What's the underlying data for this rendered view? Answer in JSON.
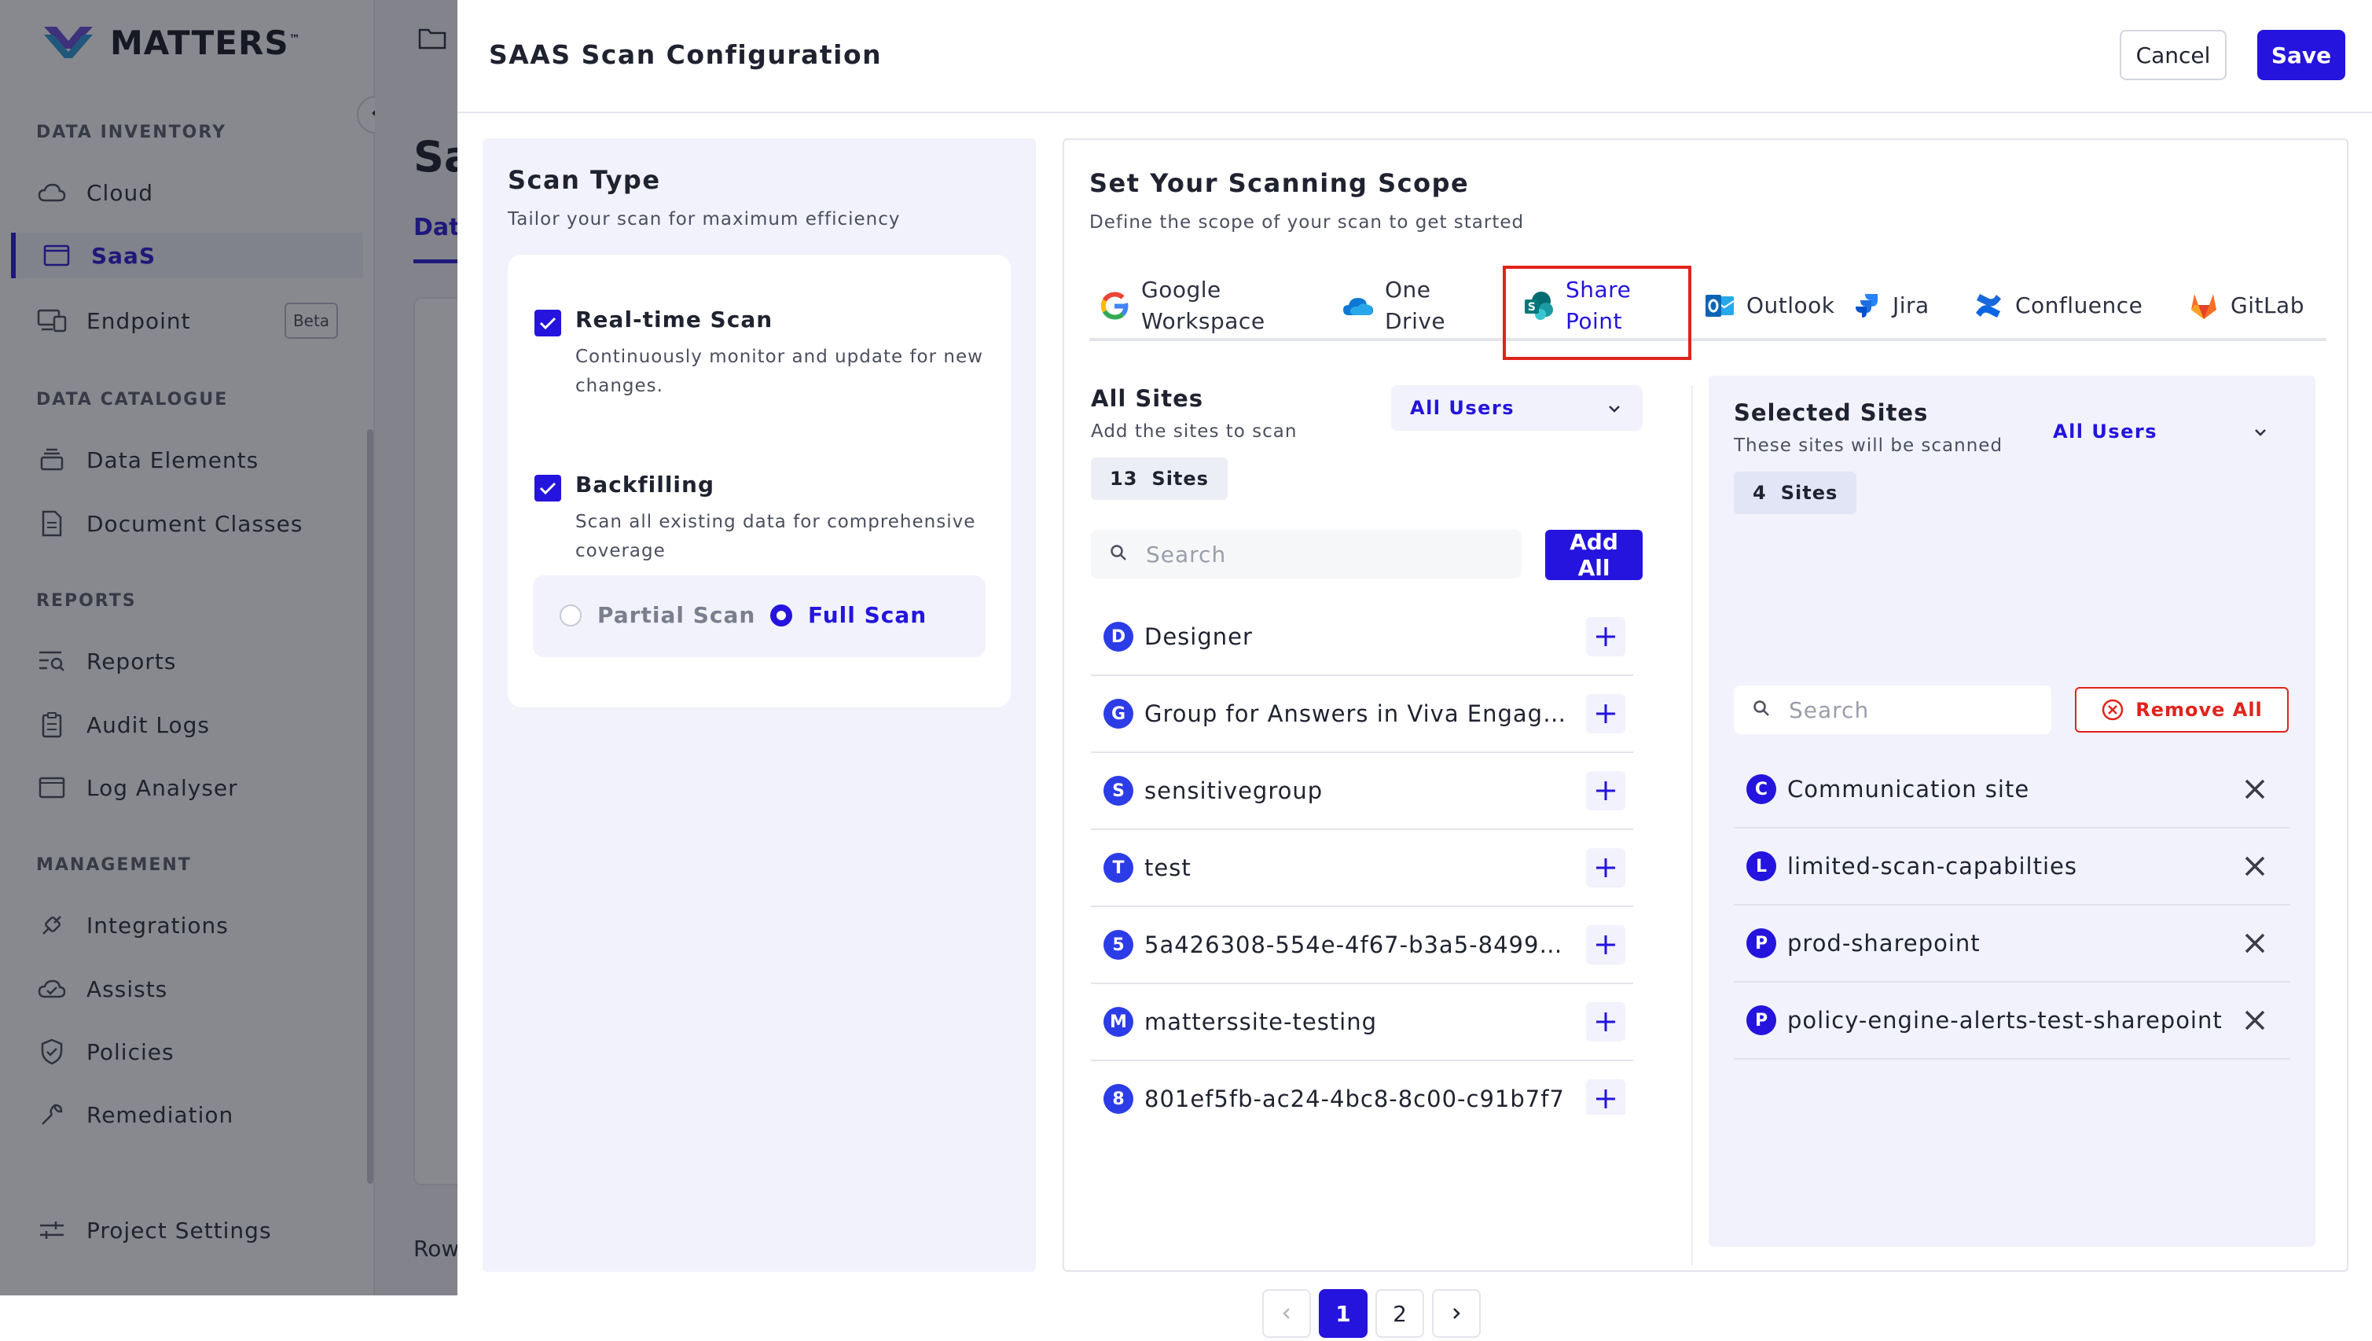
{
  "app": {
    "brand": "MATTERS",
    "brand_tm": "™"
  },
  "sidebar": {
    "sections": [
      {
        "heading": "DATA INVENTORY",
        "items": [
          {
            "label": "Cloud",
            "icon": "cloud-icon"
          },
          {
            "label": "SaaS",
            "icon": "window-icon",
            "active": true
          },
          {
            "label": "Endpoint",
            "icon": "devices-icon",
            "badge": "Beta"
          }
        ]
      },
      {
        "heading": "DATA CATALOGUE",
        "items": [
          {
            "label": "Data Elements",
            "icon": "layers-icon"
          },
          {
            "label": "Document Classes",
            "icon": "document-icon"
          }
        ]
      },
      {
        "heading": "REPORTS",
        "items": [
          {
            "label": "Reports",
            "icon": "report-search-icon"
          },
          {
            "label": "Audit Logs",
            "icon": "clipboard-icon"
          },
          {
            "label": "Log Analyser",
            "icon": "terminal-icon"
          }
        ]
      },
      {
        "heading": "MANAGEMENT",
        "items": [
          {
            "label": "Integrations",
            "icon": "plug-icon"
          },
          {
            "label": "Assists",
            "icon": "cloud-check-icon"
          },
          {
            "label": "Policies",
            "icon": "shield-check-icon"
          },
          {
            "label": "Remediation",
            "icon": "wrench-icon"
          }
        ]
      }
    ],
    "footer": {
      "label": "Project Settings",
      "icon": "sliders-icon"
    }
  },
  "background_page": {
    "title_peek": "Sa",
    "tab_peek": "Data",
    "footer_peek": "Row"
  },
  "modal": {
    "title": "SAAS Scan Configuration",
    "cancel_label": "Cancel",
    "save_label": "Save",
    "scan_type": {
      "title": "Scan Type",
      "subtitle": "Tailor your scan for maximum efficiency",
      "options": [
        {
          "label": "Real-time Scan",
          "description": "Continuously monitor and update for new changes.",
          "checked": true
        },
        {
          "label": "Backfilling",
          "description": "Scan all existing data for comprehensive coverage",
          "checked": true
        }
      ],
      "modes": [
        {
          "label": "Partial Scan",
          "selected": false
        },
        {
          "label": "Full Scan",
          "selected": true
        }
      ]
    },
    "scope": {
      "title": "Set Your Scanning Scope",
      "subtitle": "Define the scope of your scan to get started",
      "tabs": [
        {
          "line1": "Google",
          "line2": "Workspace",
          "icon": "google-icon"
        },
        {
          "line1": "One",
          "line2": "Drive",
          "icon": "onedrive-icon"
        },
        {
          "line1": "Share",
          "line2": "Point",
          "icon": "sharepoint-icon",
          "active": true
        },
        {
          "line1": "Outlook",
          "line2": "",
          "icon": "outlook-icon"
        },
        {
          "line1": "Jira",
          "line2": "",
          "icon": "jira-icon"
        },
        {
          "line1": "Confluence",
          "line2": "",
          "icon": "confluence-icon"
        },
        {
          "line1": "GitLab",
          "line2": "",
          "icon": "gitlab-icon"
        }
      ],
      "all_sites": {
        "title": "All Sites",
        "subtitle": "Add the sites to scan",
        "filter": "All Users",
        "count": "13",
        "count_label": "Sites",
        "search_placeholder": "Search",
        "add_all_label": "Add All",
        "sites": [
          {
            "initial": "D",
            "name": "Designer"
          },
          {
            "initial": "G",
            "name": "Group for Answers in Viva Engage – ..."
          },
          {
            "initial": "S",
            "name": "sensitivegroup"
          },
          {
            "initial": "T",
            "name": "test"
          },
          {
            "initial": "5",
            "name": "5a426308-554e-4f67-b3a5-8499c8..."
          },
          {
            "initial": "M",
            "name": "matterssite-testing"
          },
          {
            "initial": "8",
            "name": "801ef5fb-ac24-4bc8-8c00-c91b7f7"
          }
        ],
        "pagination": {
          "pages": [
            "1",
            "2"
          ],
          "current": "1"
        }
      },
      "selected_sites": {
        "title": "Selected Sites",
        "subtitle": "These sites will be scanned",
        "filter": "All Users",
        "count": "4",
        "count_label": "Sites",
        "search_placeholder": "Search",
        "remove_all_label": "Remove All",
        "sites": [
          {
            "initial": "C",
            "name": "Communication site"
          },
          {
            "initial": "L",
            "name": "limited-scan-capabilties"
          },
          {
            "initial": "P",
            "name": "prod-sharepoint"
          },
          {
            "initial": "P",
            "name": "policy-engine-alerts-test-sharepoint"
          }
        ]
      }
    }
  },
  "colors": {
    "accent": "#2414dd",
    "danger": "#e0241c",
    "panel_bg": "#f1f2fb",
    "avatar": "#2c3ce6"
  }
}
